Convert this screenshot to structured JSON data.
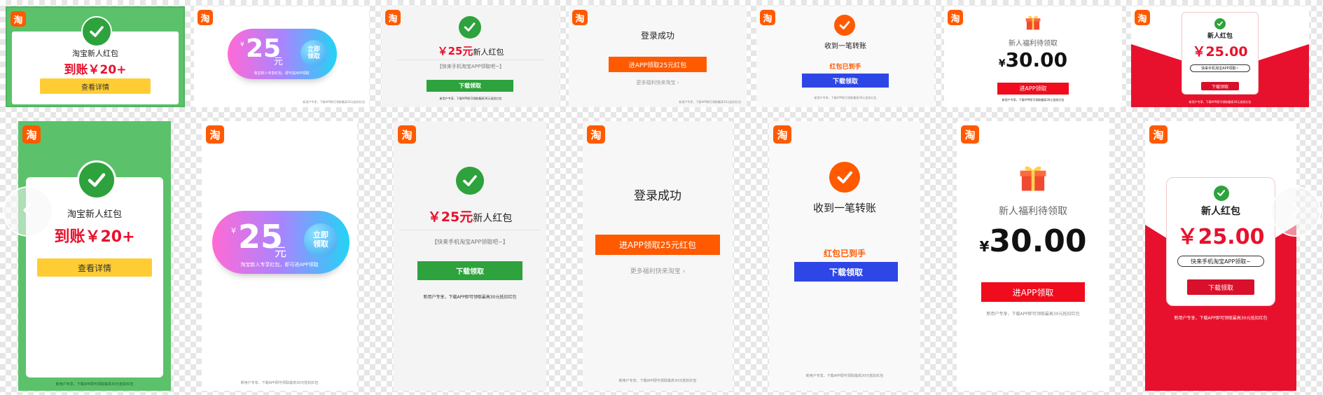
{
  "logo_char": "淘",
  "colors": {
    "green": "#5bc26b",
    "brand_orange": "#ff5a00",
    "red": "#e8112d",
    "blue": "#2e46e6",
    "yellow": "#ffcd33",
    "dark_green": "#2ea23c"
  },
  "nav": {
    "prev_icon": "chevron-left-icon",
    "next_icon": "chevron-right-icon"
  },
  "cards": {
    "c1": {
      "title": "淘宝新人红包",
      "amount": "到账￥20+",
      "button": "查看详情",
      "footer": "新用户专享，下载APP即可领取最高30元抵扣红包"
    },
    "c2": {
      "currency": "¥",
      "amount": "25",
      "unit": "元",
      "bubble_line1": "立即",
      "bubble_line2": "领取",
      "subtitle": "淘宝新人专享红包，即可进APP领取",
      "footer": "新用户专享，下载APP即可领取最高30元抵扣红包"
    },
    "c3": {
      "amount": "￥25元",
      "title": "新人红包",
      "subtitle": "【快来手机淘宝APP领取吧~】",
      "button": "下载领取",
      "footer": "新用户专享，下载APP即可领取最高30元抵扣红包"
    },
    "c4": {
      "title": "登录成功",
      "button": "进APP领取25元红包",
      "link": "更多福利快来淘宝 ›",
      "footer": "新用户专享，下载APP即可领取最高30元抵扣红包"
    },
    "c5": {
      "title": "收到一笔转账",
      "status": "红包已到手",
      "button": "下载领取",
      "footer": "新用户专享，下载APP即可领取最高30元抵扣红包"
    },
    "c6": {
      "title": "新人福利待领取",
      "currency": "¥",
      "amount": "30.00",
      "button": "进APP领取",
      "footer": "新用户专享，下载APP即可领取最高30元抵扣红包"
    },
    "c7": {
      "title": "新人红包",
      "amount": "￥25.00",
      "tag": "快来手机淘宝APP领取~",
      "button": "下载领取",
      "footer": "新用户专享，下载APP即可领取最高30元抵扣红包"
    }
  }
}
